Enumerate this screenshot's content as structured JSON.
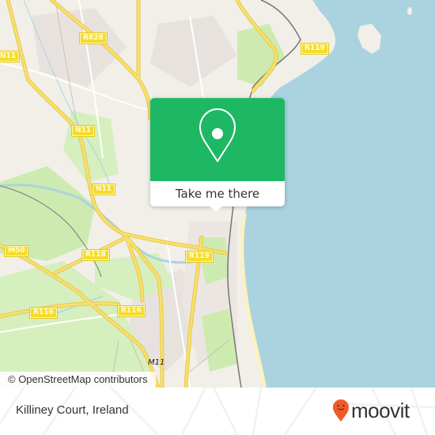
{
  "map": {
    "road_labels": [
      {
        "id": "r828",
        "text": "R828"
      },
      {
        "id": "n11-top",
        "text": "N11"
      },
      {
        "id": "n11-mid",
        "text": "N11"
      },
      {
        "id": "n11-lower",
        "text": "N11"
      },
      {
        "id": "r119-top",
        "text": "R119"
      },
      {
        "id": "m50",
        "text": "M50"
      },
      {
        "id": "r118",
        "text": "R118"
      },
      {
        "id": "r119-mid",
        "text": "R119"
      },
      {
        "id": "r116-left",
        "text": "R116"
      },
      {
        "id": "r116-mid",
        "text": "R116"
      }
    ],
    "motorway_label": "M11",
    "attribution": "© OpenStreetMap contributors",
    "colors": {
      "water": "#aad3df",
      "land": "#f2efe9",
      "park": "#cdebb0",
      "road": "#f7e06e",
      "rail": "#777777"
    }
  },
  "popup": {
    "button_label": "Take me there",
    "icon": "map-pin-icon",
    "color": "#1eb865"
  },
  "footer": {
    "place_name": "Killiney Court, Ireland",
    "brand": "moovit",
    "brand_color": "#f05a28"
  }
}
